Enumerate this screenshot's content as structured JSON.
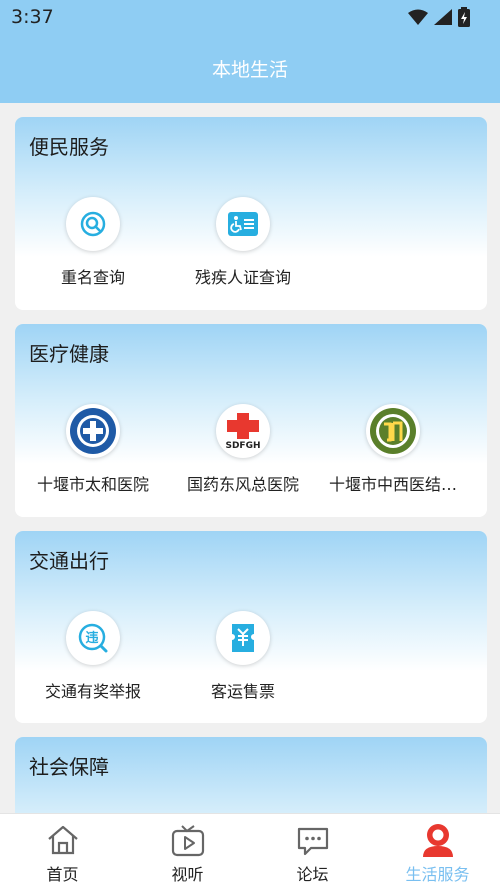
{
  "status": {
    "time": "3:37"
  },
  "header": {
    "title": "本地生活"
  },
  "sections": [
    {
      "title": "便民服务",
      "items": [
        {
          "label": "重名查询",
          "icon": "search-doc-icon"
        },
        {
          "label": "残疾人证查询",
          "icon": "disability-card-icon"
        }
      ]
    },
    {
      "title": "医疗健康",
      "items": [
        {
          "label": "十堰市太和医院",
          "icon": "taihe-hospital-logo"
        },
        {
          "label": "国药东风总医院",
          "icon": "sdfgh-logo"
        },
        {
          "label": "十堰市中西医结…",
          "icon": "tcm-hospital-logo"
        }
      ]
    },
    {
      "title": "交通出行",
      "items": [
        {
          "label": "交通有奖举报",
          "icon": "violation-report-icon"
        },
        {
          "label": "客运售票",
          "icon": "ticket-icon"
        }
      ]
    },
    {
      "title": "社会保障",
      "items": []
    }
  ],
  "tabbar": {
    "tabs": [
      {
        "label": "首页",
        "icon": "home-icon"
      },
      {
        "label": "视听",
        "icon": "tv-play-icon"
      },
      {
        "label": "论坛",
        "icon": "chat-icon"
      },
      {
        "label": "生活服务",
        "icon": "life-service-icon"
      }
    ],
    "active_index": 3
  },
  "colors": {
    "header": "#8fcdf3",
    "accent": "#79bff0",
    "service_icon": "#27aee0",
    "red": "#e8382f"
  }
}
